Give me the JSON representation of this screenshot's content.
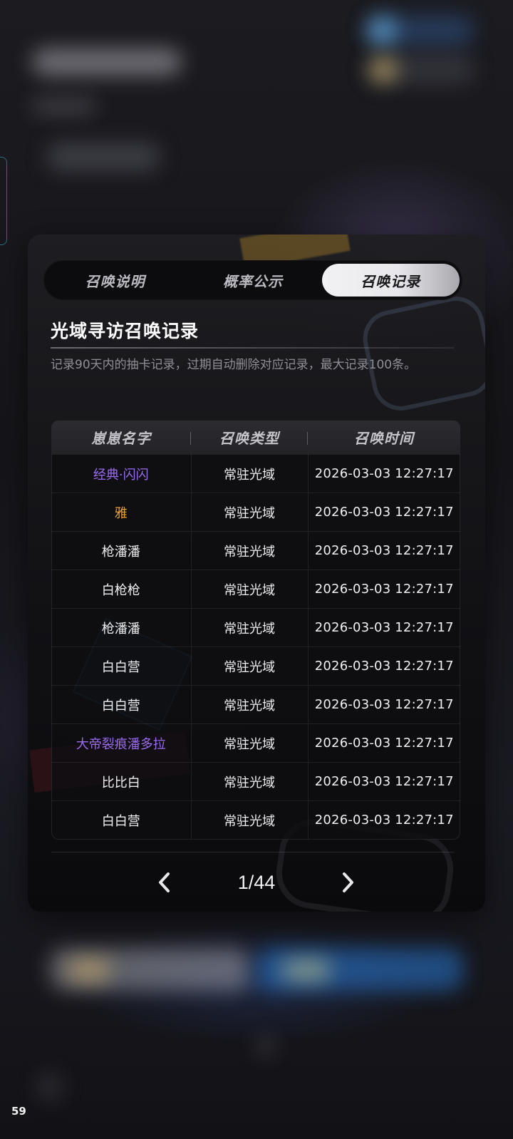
{
  "tabs": [
    {
      "label": "召唤说明",
      "active": false
    },
    {
      "label": "概率公示",
      "active": false
    },
    {
      "label": "召唤记录",
      "active": true
    }
  ],
  "record": {
    "title": "光域寻访召唤记录",
    "description": "记录90天内的抽卡记录，过期自动删除对应记录，最大记录100条。",
    "columns": [
      "崽崽名字",
      "召唤类型",
      "召唤时间"
    ],
    "rows": [
      {
        "name": "经典·闪闪",
        "type": "常驻光域",
        "time": "2026-03-03 12:27:17",
        "rarity": "purple"
      },
      {
        "name": "雅",
        "type": "常驻光域",
        "time": "2026-03-03 12:27:17",
        "rarity": "gold"
      },
      {
        "name": "枪潘潘",
        "type": "常驻光域",
        "time": "2026-03-03 12:27:17",
        "rarity": "normal"
      },
      {
        "name": "白枪枪",
        "type": "常驻光域",
        "time": "2026-03-03 12:27:17",
        "rarity": "normal"
      },
      {
        "name": "枪潘潘",
        "type": "常驻光域",
        "time": "2026-03-03 12:27:17",
        "rarity": "normal"
      },
      {
        "name": "白白营",
        "type": "常驻光域",
        "time": "2026-03-03 12:27:17",
        "rarity": "normal"
      },
      {
        "name": "白白营",
        "type": "常驻光域",
        "time": "2026-03-03 12:27:17",
        "rarity": "normal"
      },
      {
        "name": "大帝裂痕潘多拉",
        "type": "常驻光域",
        "time": "2026-03-03 12:27:17",
        "rarity": "purple"
      },
      {
        "name": "比比白",
        "type": "常驻光域",
        "time": "2026-03-03 12:27:17",
        "rarity": "normal"
      },
      {
        "name": "白白营",
        "type": "常驻光域",
        "time": "2026-03-03 12:27:17",
        "rarity": "normal"
      }
    ]
  },
  "pagination": {
    "current": "1/44",
    "prev_icon": "chevron-left-icon",
    "next_icon": "chevron-right-icon"
  },
  "colors": {
    "purple": "#9a6cf0",
    "gold": "#e9a23b",
    "normal": "#f0f0f2"
  },
  "fps_counter": "59"
}
